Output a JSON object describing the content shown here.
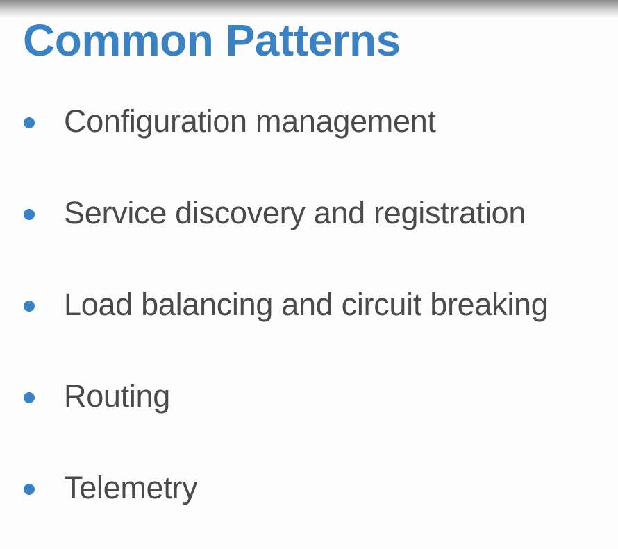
{
  "slide": {
    "title": "Common Patterns",
    "bullets": [
      "Configuration management",
      "Service discovery and registration",
      "Load balancing and circuit breaking",
      "Routing",
      "Telemetry"
    ],
    "accent_color": "#3b82c4",
    "text_color": "#4a4a4a"
  }
}
